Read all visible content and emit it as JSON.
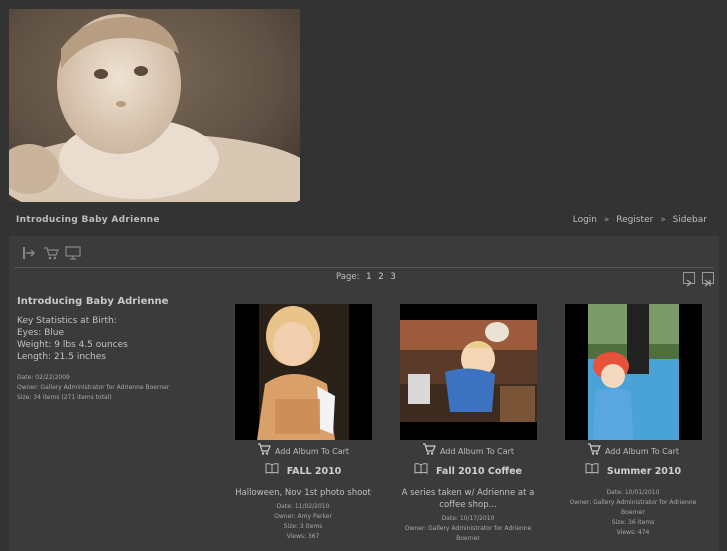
{
  "header": {
    "site_title": "Introducing Baby Adrienne",
    "nav": {
      "login": "Login",
      "register": "Register",
      "sidebar": "Sidebar",
      "separator": "»"
    }
  },
  "toolbar": {
    "icons": [
      "album-view-icon",
      "cart-icon",
      "slideshow-icon"
    ]
  },
  "pager": {
    "label": "Page:",
    "pages": [
      "1",
      "2",
      "3"
    ]
  },
  "album": {
    "title": "Introducing Baby Adrienne",
    "desc_line1": "Key Statistics at Birth:",
    "desc_line2": "Eyes: Blue",
    "desc_line3": "Weight: 9 lbs 4.5 ounces",
    "desc_line4": "Length: 21.5 inches",
    "date": "Date: 02/22/2009",
    "owner": "Owner: Gallery Administrator for Adrienne Boerner",
    "size": "Size: 34 items (271 items total)"
  },
  "subalbums": [
    {
      "cart": "Add Album To Cart",
      "title": "FALL 2010",
      "desc": "Halloween, Nov 1st photo shoot",
      "date": "Date: 11/02/2010",
      "owner": "Owner: Amy Parker",
      "size": "Size: 3 items",
      "views": "Views: 367"
    },
    {
      "cart": "Add Album To Cart",
      "title": "Fall 2010 Coffee",
      "desc": "A series taken w/ Adrienne at a coffee shop...",
      "date": "Date: 10/17/2010",
      "owner": "Owner: Gallery Administrator for Adrienne Boerner",
      "size": "",
      "views": ""
    },
    {
      "cart": "Add Album To Cart",
      "title": "Summer 2010",
      "desc": "",
      "date": "Date: 10/01/2010",
      "owner": "Owner: Gallery Administrator for Adrienne Boerner",
      "size": "Size: 36 items",
      "views": "Views: 474"
    }
  ]
}
